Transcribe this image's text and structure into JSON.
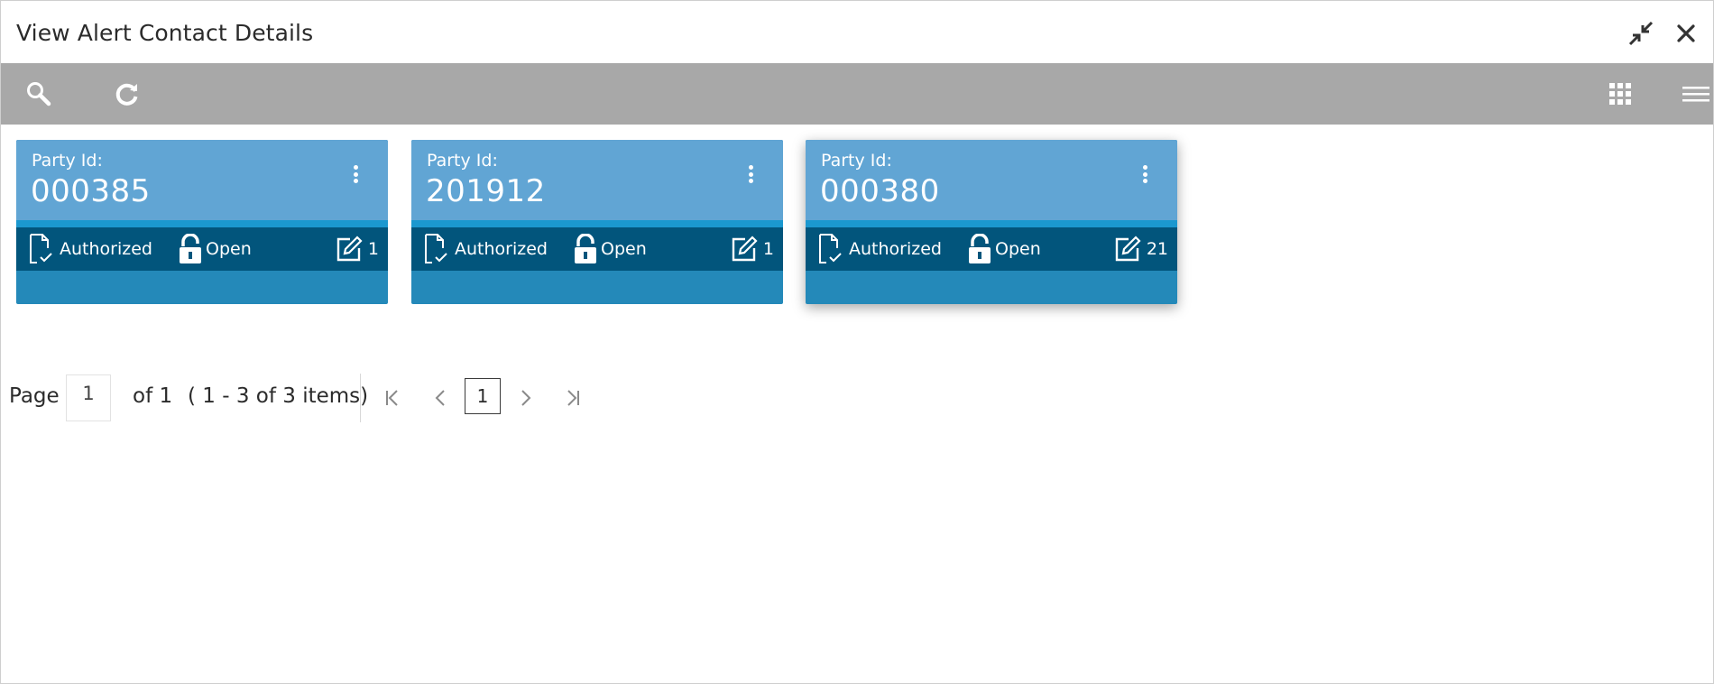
{
  "window": {
    "title": "View Alert Contact Details",
    "actions": {
      "minimize_icon": "collapse-arrows-icon",
      "close_icon": "close-icon"
    }
  },
  "toolbar": {
    "left_icons": [
      "search-icon",
      "refresh-icon"
    ],
    "right_icons": [
      "grid-view-icon",
      "list-view-icon"
    ],
    "bg_color": "#a8a8a8"
  },
  "cards": [
    {
      "party_label": "Party Id:",
      "party_id": "000385",
      "auth_status": "Authorized",
      "record_status": "Open",
      "modification_count": "1"
    },
    {
      "party_label": "Party Id:",
      "party_id": "201912",
      "auth_status": "Authorized",
      "record_status": "Open",
      "modification_count": "1"
    },
    {
      "party_label": "Party Id:",
      "party_id": "000380",
      "auth_status": "Authorized",
      "record_status": "Open",
      "modification_count": "21"
    }
  ],
  "colors": {
    "card_header": "#61a5d4",
    "card_stripe": "#1b98cf",
    "card_status_bar": "#02557c",
    "card_footer": "#2489b9"
  },
  "pagination": {
    "page_label": "Page",
    "page_value": "1",
    "of_label": "of 1",
    "range_label": "( 1 - 3 of 3 items)",
    "current_page": "1"
  }
}
